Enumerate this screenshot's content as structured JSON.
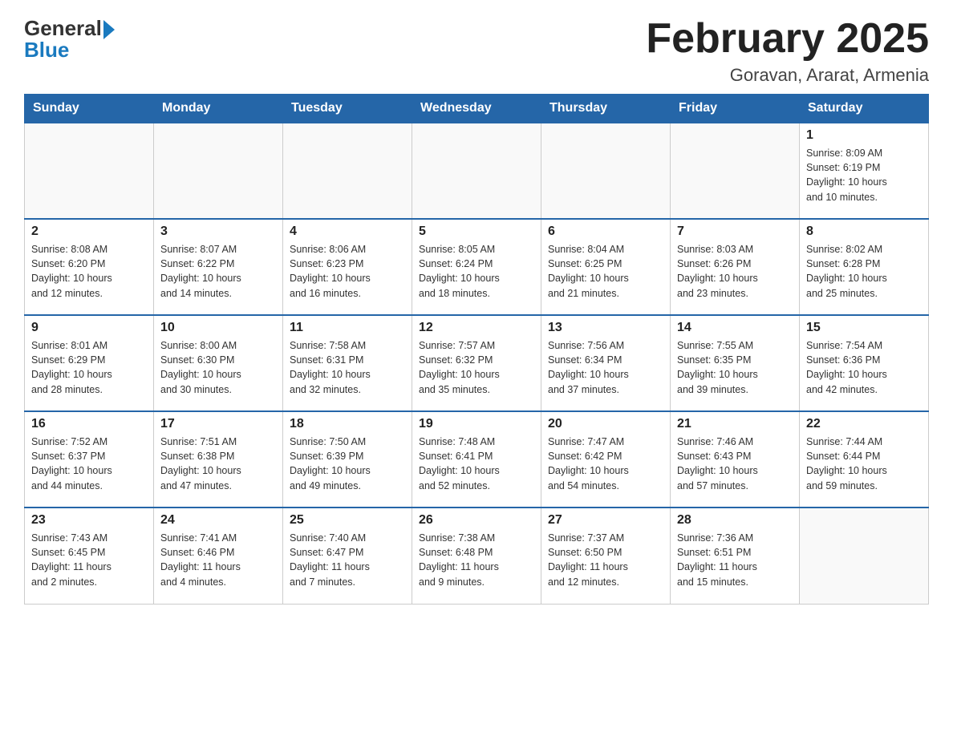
{
  "logo": {
    "general": "General",
    "blue": "Blue"
  },
  "title": {
    "month": "February 2025",
    "location": "Goravan, Ararat, Armenia"
  },
  "weekdays": [
    "Sunday",
    "Monday",
    "Tuesday",
    "Wednesday",
    "Thursday",
    "Friday",
    "Saturday"
  ],
  "weeks": [
    [
      {
        "day": "",
        "info": ""
      },
      {
        "day": "",
        "info": ""
      },
      {
        "day": "",
        "info": ""
      },
      {
        "day": "",
        "info": ""
      },
      {
        "day": "",
        "info": ""
      },
      {
        "day": "",
        "info": ""
      },
      {
        "day": "1",
        "info": "Sunrise: 8:09 AM\nSunset: 6:19 PM\nDaylight: 10 hours\nand 10 minutes."
      }
    ],
    [
      {
        "day": "2",
        "info": "Sunrise: 8:08 AM\nSunset: 6:20 PM\nDaylight: 10 hours\nand 12 minutes."
      },
      {
        "day": "3",
        "info": "Sunrise: 8:07 AM\nSunset: 6:22 PM\nDaylight: 10 hours\nand 14 minutes."
      },
      {
        "day": "4",
        "info": "Sunrise: 8:06 AM\nSunset: 6:23 PM\nDaylight: 10 hours\nand 16 minutes."
      },
      {
        "day": "5",
        "info": "Sunrise: 8:05 AM\nSunset: 6:24 PM\nDaylight: 10 hours\nand 18 minutes."
      },
      {
        "day": "6",
        "info": "Sunrise: 8:04 AM\nSunset: 6:25 PM\nDaylight: 10 hours\nand 21 minutes."
      },
      {
        "day": "7",
        "info": "Sunrise: 8:03 AM\nSunset: 6:26 PM\nDaylight: 10 hours\nand 23 minutes."
      },
      {
        "day": "8",
        "info": "Sunrise: 8:02 AM\nSunset: 6:28 PM\nDaylight: 10 hours\nand 25 minutes."
      }
    ],
    [
      {
        "day": "9",
        "info": "Sunrise: 8:01 AM\nSunset: 6:29 PM\nDaylight: 10 hours\nand 28 minutes."
      },
      {
        "day": "10",
        "info": "Sunrise: 8:00 AM\nSunset: 6:30 PM\nDaylight: 10 hours\nand 30 minutes."
      },
      {
        "day": "11",
        "info": "Sunrise: 7:58 AM\nSunset: 6:31 PM\nDaylight: 10 hours\nand 32 minutes."
      },
      {
        "day": "12",
        "info": "Sunrise: 7:57 AM\nSunset: 6:32 PM\nDaylight: 10 hours\nand 35 minutes."
      },
      {
        "day": "13",
        "info": "Sunrise: 7:56 AM\nSunset: 6:34 PM\nDaylight: 10 hours\nand 37 minutes."
      },
      {
        "day": "14",
        "info": "Sunrise: 7:55 AM\nSunset: 6:35 PM\nDaylight: 10 hours\nand 39 minutes."
      },
      {
        "day": "15",
        "info": "Sunrise: 7:54 AM\nSunset: 6:36 PM\nDaylight: 10 hours\nand 42 minutes."
      }
    ],
    [
      {
        "day": "16",
        "info": "Sunrise: 7:52 AM\nSunset: 6:37 PM\nDaylight: 10 hours\nand 44 minutes."
      },
      {
        "day": "17",
        "info": "Sunrise: 7:51 AM\nSunset: 6:38 PM\nDaylight: 10 hours\nand 47 minutes."
      },
      {
        "day": "18",
        "info": "Sunrise: 7:50 AM\nSunset: 6:39 PM\nDaylight: 10 hours\nand 49 minutes."
      },
      {
        "day": "19",
        "info": "Sunrise: 7:48 AM\nSunset: 6:41 PM\nDaylight: 10 hours\nand 52 minutes."
      },
      {
        "day": "20",
        "info": "Sunrise: 7:47 AM\nSunset: 6:42 PM\nDaylight: 10 hours\nand 54 minutes."
      },
      {
        "day": "21",
        "info": "Sunrise: 7:46 AM\nSunset: 6:43 PM\nDaylight: 10 hours\nand 57 minutes."
      },
      {
        "day": "22",
        "info": "Sunrise: 7:44 AM\nSunset: 6:44 PM\nDaylight: 10 hours\nand 59 minutes."
      }
    ],
    [
      {
        "day": "23",
        "info": "Sunrise: 7:43 AM\nSunset: 6:45 PM\nDaylight: 11 hours\nand 2 minutes."
      },
      {
        "day": "24",
        "info": "Sunrise: 7:41 AM\nSunset: 6:46 PM\nDaylight: 11 hours\nand 4 minutes."
      },
      {
        "day": "25",
        "info": "Sunrise: 7:40 AM\nSunset: 6:47 PM\nDaylight: 11 hours\nand 7 minutes."
      },
      {
        "day": "26",
        "info": "Sunrise: 7:38 AM\nSunset: 6:48 PM\nDaylight: 11 hours\nand 9 minutes."
      },
      {
        "day": "27",
        "info": "Sunrise: 7:37 AM\nSunset: 6:50 PM\nDaylight: 11 hours\nand 12 minutes."
      },
      {
        "day": "28",
        "info": "Sunrise: 7:36 AM\nSunset: 6:51 PM\nDaylight: 11 hours\nand 15 minutes."
      },
      {
        "day": "",
        "info": ""
      }
    ]
  ]
}
